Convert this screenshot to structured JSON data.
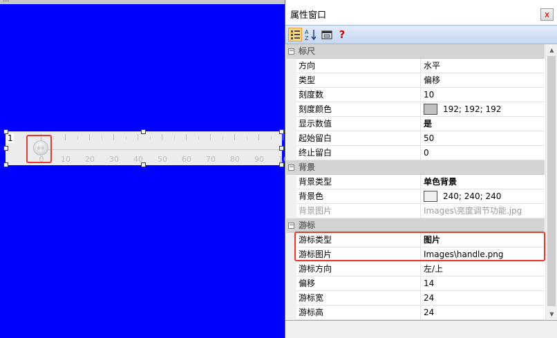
{
  "canvas": {
    "top_strip_text": "...",
    "background_color": "#0000ff",
    "ruler": {
      "current_value": "1",
      "tick_labels": [
        "0",
        "10",
        "20",
        "30",
        "40",
        "50",
        "60",
        "70",
        "80",
        "90",
        "10"
      ],
      "handle_icon": "knob-handle-icon"
    },
    "highlight_color": "#e53a2b"
  },
  "property_window": {
    "title": "属性窗口",
    "close_label": "x",
    "toolbar": {
      "categorized_icon": "categorized-view-icon",
      "alphabetical_icon": "sort-alphabetical-icon",
      "property_pages_icon": "property-pages-icon",
      "help_icon": "help-icon",
      "help_label": "?"
    },
    "categories": [
      {
        "name": "标尺",
        "toggle": "−",
        "rows": [
          {
            "name": "方向",
            "value": "水平"
          },
          {
            "name": "类型",
            "value": "偏移"
          },
          {
            "name": "刻度数",
            "value": "10"
          },
          {
            "name": "刻度颜色",
            "value": "192; 192; 192",
            "swatch": "#c0c0c0"
          },
          {
            "name": "显示数值",
            "value": "是",
            "bold": true
          },
          {
            "name": "起始留白",
            "value": "50"
          },
          {
            "name": "终止留白",
            "value": "0"
          }
        ]
      },
      {
        "name": "背景",
        "toggle": "−",
        "rows": [
          {
            "name": "背景类型",
            "value": "单色背景",
            "bold": true
          },
          {
            "name": "背景色",
            "value": "240; 240; 240",
            "swatch": "#f0f0f0"
          },
          {
            "name": "背景图片",
            "value": "Images\\亮度调节功能.jpg",
            "disabled": true
          }
        ]
      },
      {
        "name": "游标",
        "toggle": "−",
        "rows": [
          {
            "name": "游标类型",
            "value": "图片",
            "bold": true
          },
          {
            "name": "游标图片",
            "value": "Images\\handle.png"
          },
          {
            "name": "游标方向",
            "value": "左/上"
          },
          {
            "name": "偏移",
            "value": "14"
          },
          {
            "name": "游标宽",
            "value": "24"
          },
          {
            "name": "游标高",
            "value": "24"
          }
        ]
      }
    ]
  }
}
